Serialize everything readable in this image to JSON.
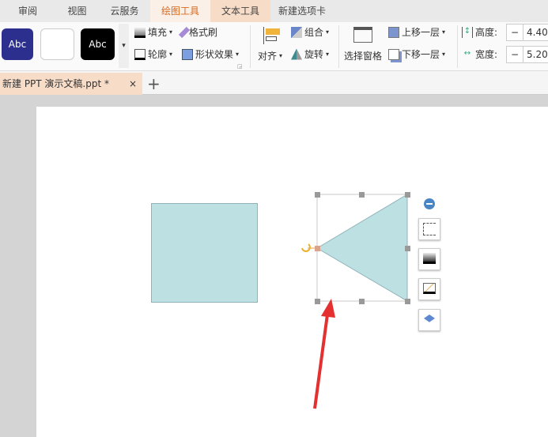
{
  "menu_tabs": [
    "审阅",
    "视图",
    "云服务",
    "绘图工具",
    "文本工具",
    "新建选项卡"
  ],
  "ribbon": {
    "style_presets": [
      "Abc",
      "",
      "Abc"
    ],
    "fill": "填充",
    "format_painter": "格式刷",
    "outline": "轮廓",
    "shape_effects": "形状效果",
    "align": "对齐",
    "group": "组合",
    "rotate": "旋转",
    "selection_pane": "选择窗格",
    "bring_forward": "上移一层",
    "send_backward": "下移一层",
    "height_label": "高度:",
    "height_value": "4.40",
    "width_label": "宽度:",
    "width_value": "5.20",
    "minus": "−"
  },
  "doc_tab": {
    "title": "新建 PPT 演示文稿.ppt *",
    "close": "×",
    "add": "+"
  },
  "colors": {
    "shape_fill": "#bde0e3",
    "active_tab": "#fbe3d2",
    "arrow": "#e53030",
    "accent": "#e8772e"
  }
}
